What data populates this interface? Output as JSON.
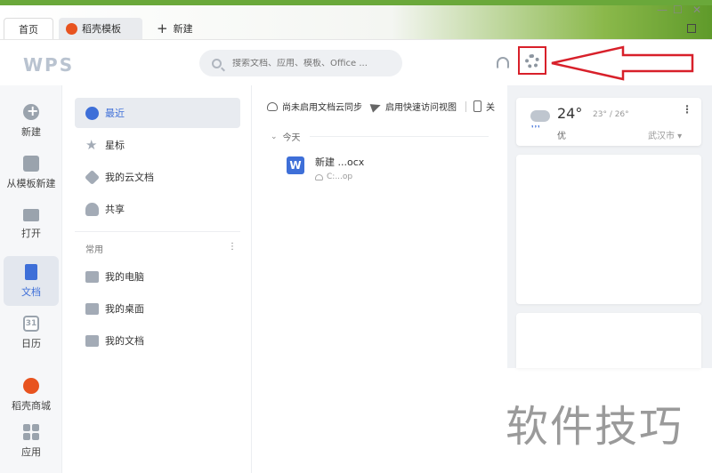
{
  "tabs": [
    {
      "label": "首页"
    },
    {
      "label": "稻壳模板"
    },
    {
      "label": "新建"
    }
  ],
  "header": {
    "logo": "WPS",
    "search_placeholder": "搜索文档、应用、模板、Office ..."
  },
  "rail": [
    {
      "label": "新建",
      "icon": "plus-circle-icon"
    },
    {
      "label": "从模板新建",
      "icon": "template-icon"
    },
    {
      "label": "打开",
      "icon": "folder-icon"
    },
    {
      "label": "文档",
      "icon": "document-icon",
      "active": true
    },
    {
      "label": "日历",
      "icon": "calendar-icon",
      "glyph": "31"
    },
    {
      "label": "稻壳商城",
      "icon": "docer-mall-icon"
    },
    {
      "label": "应用",
      "icon": "apps-grid-icon"
    }
  ],
  "nav": {
    "items": [
      {
        "label": "最近",
        "icon": "clock-icon",
        "active": true
      },
      {
        "label": "星标",
        "icon": "star-icon"
      },
      {
        "label": "我的云文档",
        "icon": "cloud-doc-icon"
      },
      {
        "label": "共享",
        "icon": "share-users-icon"
      }
    ],
    "section_label": "常用",
    "section_more": "⋮",
    "common": [
      {
        "label": "我的电脑",
        "icon": "computer-icon"
      },
      {
        "label": "我的桌面",
        "icon": "desktop-icon"
      },
      {
        "label": "我的文档",
        "icon": "folder-docs-icon"
      }
    ]
  },
  "toolbar": {
    "cloud_sync": "尚未启用文档云同步",
    "quick_view": "启用快速访问视图",
    "more": "关"
  },
  "recent": {
    "group_label": "今天",
    "files": [
      {
        "name": "新建 ...ocx",
        "location": "C:...op",
        "type_glyph": "W"
      }
    ]
  },
  "weather": {
    "temp": "24°",
    "range": "23° / 26°",
    "air_quality": "优",
    "city": "武汉市 ▾",
    "more": "⋮"
  },
  "watermark": "软件技巧",
  "colors": {
    "accent": "#3e6fd8",
    "annotation_red": "#d8202a",
    "docer_orange": "#e8531f"
  }
}
